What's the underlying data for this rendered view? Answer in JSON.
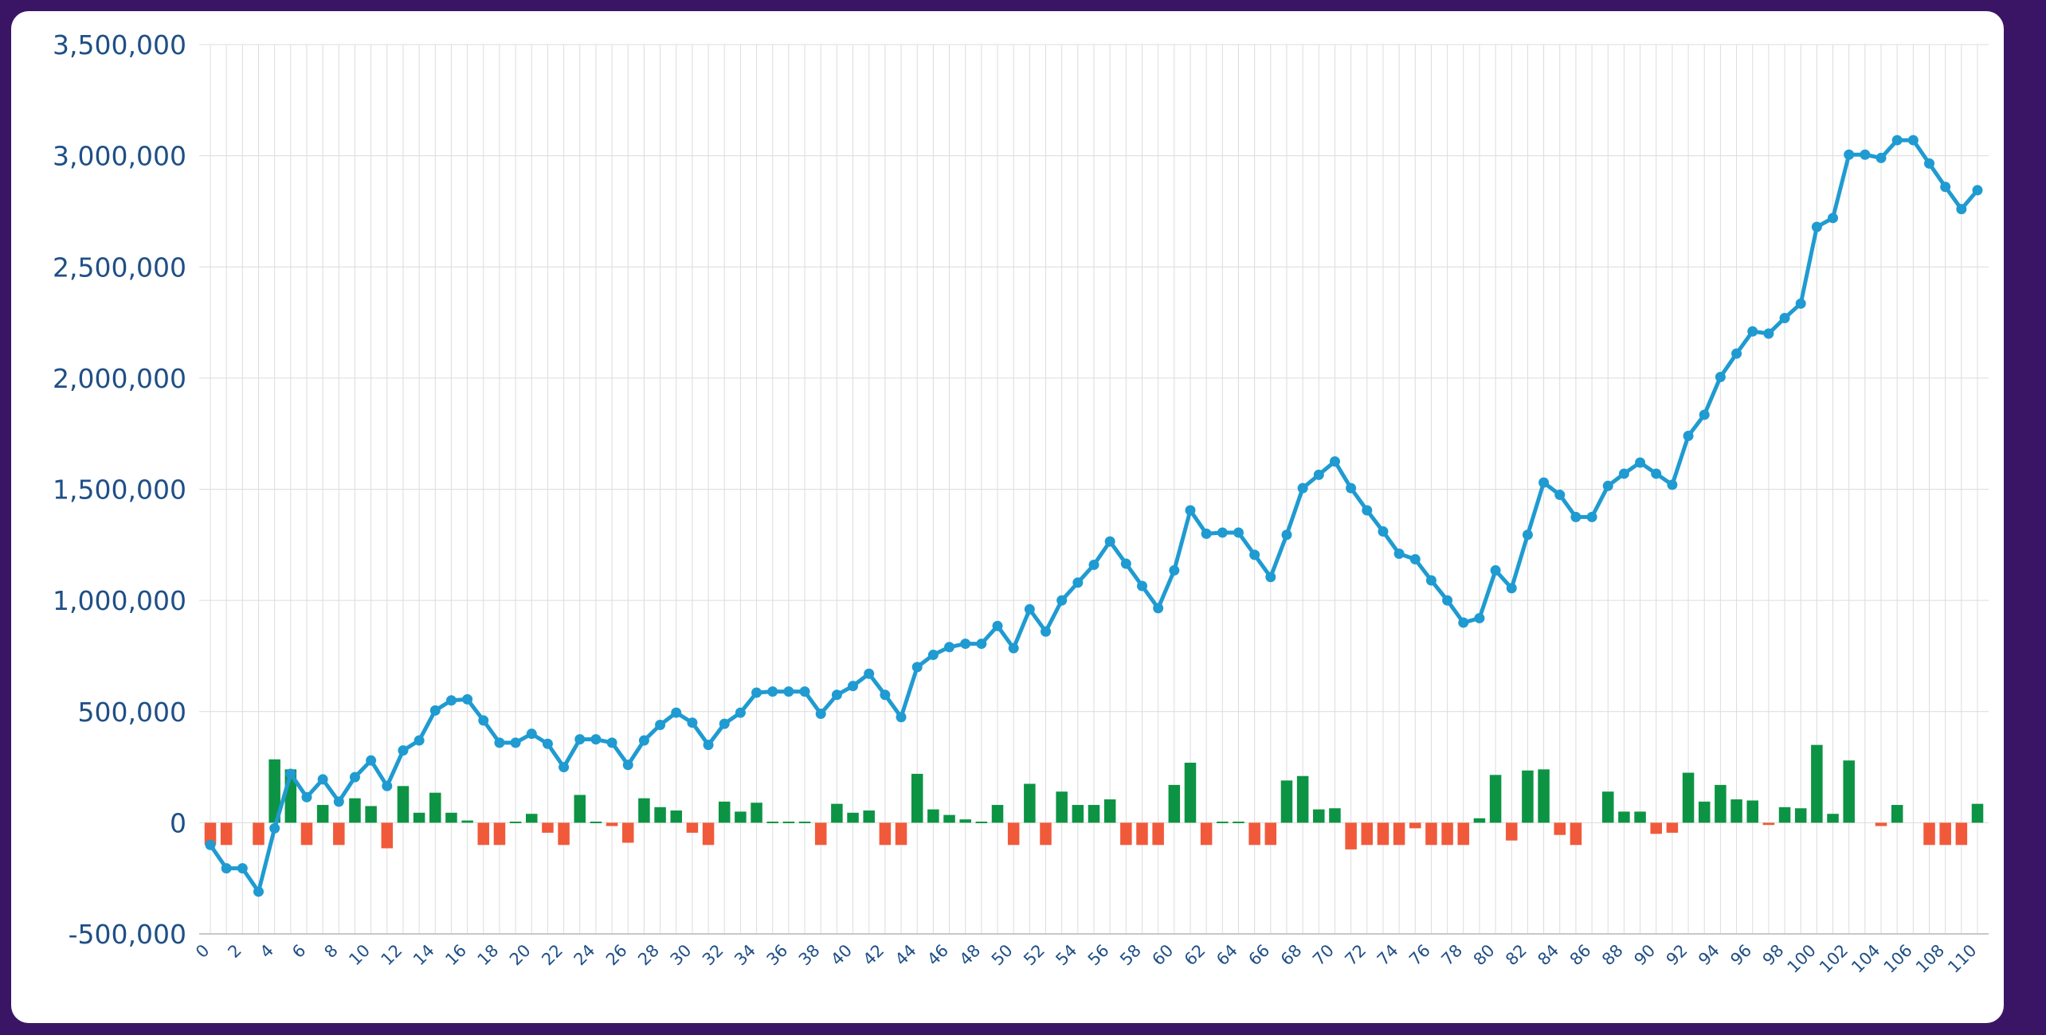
{
  "chart_data": {
    "type": "bar+line",
    "x": [
      0,
      1,
      2,
      3,
      4,
      5,
      6,
      7,
      8,
      9,
      10,
      11,
      12,
      13,
      14,
      15,
      16,
      17,
      18,
      19,
      20,
      21,
      22,
      23,
      24,
      25,
      26,
      27,
      28,
      29,
      30,
      31,
      32,
      33,
      34,
      35,
      36,
      37,
      38,
      39,
      40,
      41,
      42,
      43,
      44,
      45,
      46,
      47,
      48,
      49,
      50,
      51,
      52,
      53,
      54,
      55,
      56,
      57,
      58,
      59,
      60,
      61,
      62,
      63,
      64,
      65,
      66,
      67,
      68,
      69,
      70,
      71,
      72,
      73,
      74,
      75,
      76,
      77,
      78,
      79,
      80,
      81,
      82,
      83,
      84,
      85,
      86,
      87,
      88,
      89,
      90,
      91,
      92,
      93,
      94,
      95,
      96,
      97,
      98,
      99,
      100,
      101,
      102,
      103,
      104,
      105,
      106,
      107,
      108,
      109,
      110
    ],
    "x_tick_labels": [
      "0",
      "2",
      "4",
      "6",
      "8",
      "10",
      "12",
      "14",
      "16",
      "18",
      "20",
      "22",
      "24",
      "26",
      "28",
      "30",
      "32",
      "34",
      "36",
      "38",
      "40",
      "42",
      "44",
      "46",
      "48",
      "50",
      "52",
      "54",
      "56",
      "58",
      "60",
      "62",
      "64",
      "66",
      "68",
      "70",
      "72",
      "74",
      "76",
      "78",
      "80",
      "82",
      "84",
      "86",
      "88",
      "90",
      "92",
      "94",
      "96",
      "98",
      "100",
      "102",
      "104",
      "106",
      "108",
      "110"
    ],
    "y_tick_labels": [
      "-500,000",
      "0",
      "500,000",
      "1,000,000",
      "1,500,000",
      "2,000,000",
      "2,500,000",
      "3,000,000",
      "3,500,000"
    ],
    "ylim": [
      -500000,
      3500000
    ],
    "grid": true,
    "series": [
      {
        "type": "bar",
        "values": [
          -100000,
          -100000,
          0,
          -100000,
          285000,
          240000,
          -100000,
          80000,
          -100000,
          110000,
          75000,
          -115000,
          165000,
          45000,
          135000,
          45000,
          10000,
          -100000,
          -100000,
          5000,
          40000,
          -45000,
          -100000,
          125000,
          5000,
          -15000,
          -90000,
          110000,
          70000,
          55000,
          -45000,
          -100000,
          95000,
          50000,
          90000,
          5000,
          5000,
          5000,
          -100000,
          85000,
          45000,
          55000,
          -100000,
          -100000,
          220000,
          60000,
          35000,
          15000,
          5000,
          80000,
          -100000,
          175000,
          -100000,
          140000,
          80000,
          80000,
          105000,
          -100000,
          -100000,
          -100000,
          170000,
          270000,
          -100000,
          5000,
          5000,
          -100000,
          -100000,
          190000,
          210000,
          60000,
          65000,
          -120000,
          -100000,
          -100000,
          -100000,
          -25000,
          -100000,
          -100000,
          -100000,
          20000,
          215000,
          -80000,
          235000,
          240000,
          -55000,
          -100000,
          0,
          140000,
          50000,
          50000,
          -50000,
          -45000,
          225000,
          95000,
          170000,
          105000,
          100000,
          -10000,
          70000,
          65000,
          350000,
          40000,
          280000,
          0,
          -15000,
          80000,
          0,
          -100000,
          -100000,
          -100000,
          85000
        ]
      },
      {
        "type": "line",
        "values": [
          -100000,
          -205000,
          -205000,
          -310000,
          -25000,
          220000,
          115000,
          195000,
          95000,
          205000,
          280000,
          165000,
          325000,
          370000,
          505000,
          550000,
          555000,
          460000,
          360000,
          360000,
          400000,
          355000,
          250000,
          375000,
          375000,
          360000,
          260000,
          370000,
          440000,
          495000,
          450000,
          350000,
          445000,
          495000,
          585000,
          590000,
          590000,
          590000,
          490000,
          575000,
          615000,
          670000,
          575000,
          475000,
          700000,
          755000,
          790000,
          805000,
          805000,
          885000,
          785000,
          960000,
          860000,
          1000000,
          1080000,
          1160000,
          1265000,
          1165000,
          1065000,
          965000,
          1135000,
          1405000,
          1300000,
          1305000,
          1305000,
          1205000,
          1105000,
          1295000,
          1505000,
          1565000,
          1625000,
          1505000,
          1405000,
          1310000,
          1210000,
          1185000,
          1090000,
          1000000,
          900000,
          920000,
          1135000,
          1055000,
          1295000,
          1530000,
          1475000,
          1375000,
          1375000,
          1515000,
          1570000,
          1620000,
          1570000,
          1520000,
          1740000,
          1835000,
          2005000,
          2110000,
          2210000,
          2200000,
          2270000,
          2335000,
          2680000,
          2720000,
          3005000,
          3005000,
          2990000,
          3070000,
          3070000,
          2965000,
          2860000,
          2760000,
          2845000
        ]
      }
    ]
  },
  "colors": {
    "frame": "#3b1565",
    "line": "#1f9bd1",
    "bar_positive": "#0c9444",
    "bar_negative": "#f05a3a",
    "grid": "#dcdcdc",
    "tick_text": "#1f4f86"
  }
}
